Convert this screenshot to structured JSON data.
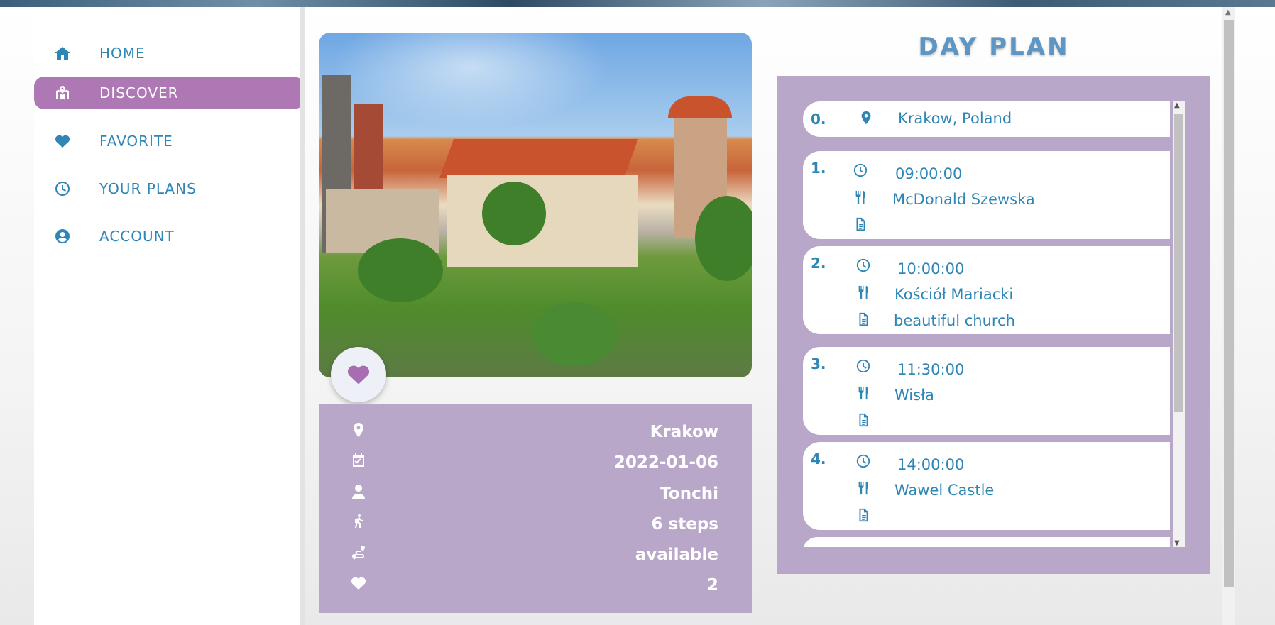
{
  "nav": {
    "items": [
      {
        "label": "HOME",
        "icon": "home-icon"
      },
      {
        "label": "DISCOVER",
        "icon": "map-marked-icon",
        "active": true
      },
      {
        "label": "FAVORITE",
        "icon": "heart-icon"
      },
      {
        "label": "YOUR PLANS",
        "icon": "clock-icon"
      },
      {
        "label": "ACCOUNT",
        "icon": "user-circle-icon"
      }
    ],
    "active_color": "#ae78b5",
    "text_color": "#2f86b5"
  },
  "plan_info": {
    "city": "Krakow",
    "date": "2022-01-06",
    "author": "Tonchi",
    "steps": "6 steps",
    "availability": "available",
    "likes": "2"
  },
  "day_plan": {
    "title": "DAY PLAN",
    "start": {
      "index": "0.",
      "location": "Krakow, Poland"
    },
    "steps": [
      {
        "index": "1.",
        "time": "09:00:00",
        "place": "McDonald Szewska",
        "note": ""
      },
      {
        "index": "2.",
        "time": "10:00:00",
        "place": "Kościół Mariacki",
        "note": "beautiful church"
      },
      {
        "index": "3.",
        "time": "11:30:00",
        "place": "Wisła",
        "note": ""
      },
      {
        "index": "4.",
        "time": "14:00:00",
        "place": "Wawel Castle",
        "note": ""
      }
    ],
    "panel_color": "#b8a7c9"
  }
}
